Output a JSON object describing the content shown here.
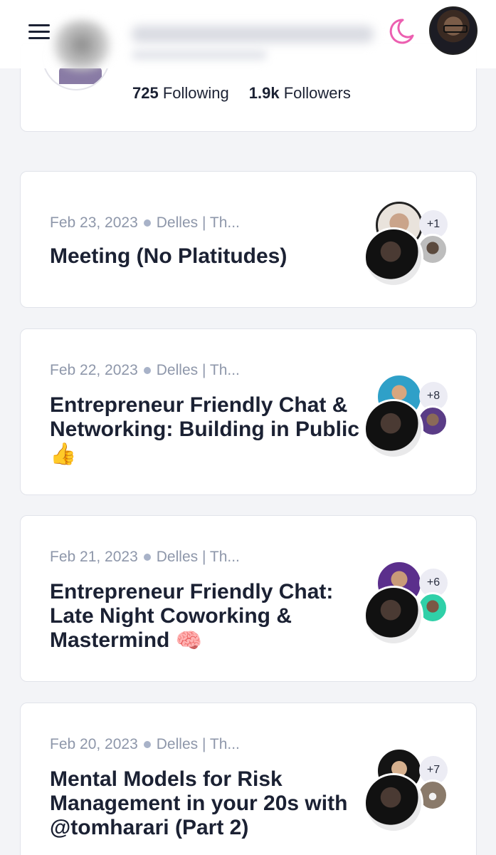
{
  "profile": {
    "following_count": "725",
    "following_label": "Following",
    "followers_count": "1.9k",
    "followers_label": "Followers"
  },
  "header": {
    "menu_icon": "hamburger-menu-icon",
    "theme_icon": "moon-icon",
    "theme_icon_color": "#ec5fb0"
  },
  "events": [
    {
      "date": "Feb 23, 2023",
      "host": "Delles | Th...",
      "title": "Meeting (No Platitudes)",
      "emoji": "",
      "extra_attendees": "+1"
    },
    {
      "date": "Feb 22, 2023",
      "host": "Delles | Th...",
      "title": "Entrepreneur Friendly Chat & Networking: Building in Public",
      "emoji": "👍",
      "extra_attendees": "+8"
    },
    {
      "date": "Feb 21, 2023",
      "host": "Delles | Th...",
      "title": "Entrepreneur Friendly Chat: Late Night Coworking & Mastermind",
      "emoji": "🧠",
      "extra_attendees": "+6"
    },
    {
      "date": "Feb 20, 2023",
      "host": "Delles | Th...",
      "title": "Mental Models for Risk Management in your 20s with @tomharari (Part 2)",
      "emoji": "",
      "extra_attendees": "+7"
    }
  ]
}
